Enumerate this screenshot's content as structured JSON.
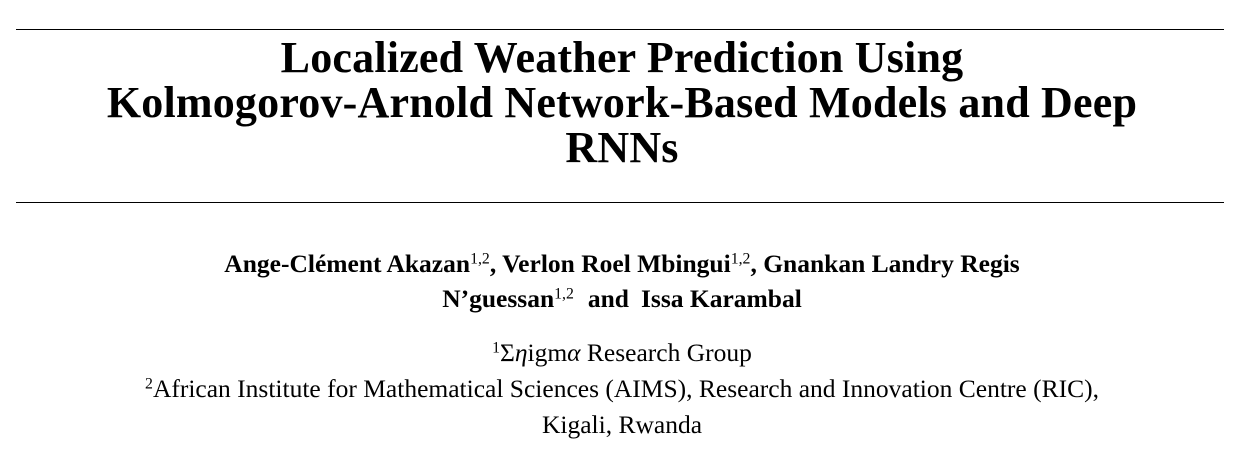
{
  "title": {
    "lines": [
      "Localized Weather Prediction Using",
      "Kolmogorov-Arnold Network-Based Models and Deep",
      "RNNs"
    ]
  },
  "authors": [
    {
      "name": "Ange-Clément Akazan",
      "affil": "1,2",
      "sep": ", "
    },
    {
      "name": "Verlon Roel Mbingui",
      "affil": "1,2",
      "sep": ", "
    },
    {
      "name": "Gnankan Landry Regis",
      "affil": "",
      "sep": ""
    },
    {
      "name": "N’guessan",
      "affil": "1,2",
      "sep": ""
    },
    {
      "name": "Issa Karambal",
      "affil": "",
      "sep": ""
    }
  ],
  "and_word": "and",
  "affiliations": [
    {
      "mark": "1",
      "prefix_sigma": "Σ",
      "eta": "η",
      "middle": "igm",
      "alpha": "α",
      "text": " Research Group"
    },
    {
      "mark": "2",
      "text": "African Institute for Mathematical Sciences (AIMS), Research and Innovation Centre (RIC),"
    },
    {
      "mark": "",
      "text": "Kigali, Rwanda"
    }
  ]
}
